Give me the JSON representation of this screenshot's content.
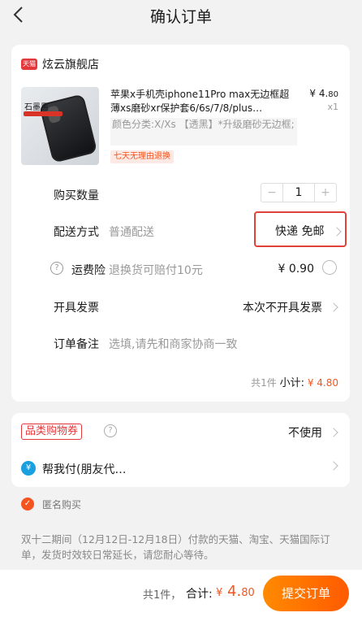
{
  "header": {
    "title": "确认订单"
  },
  "shop": {
    "logo_text": "天猫",
    "name": "炫云旗舰店"
  },
  "product": {
    "title": "苹果x手机壳iphone11Pro max无边框超薄xs磨砂xr保护套6/6s/7/8/plus…",
    "price_symbol": "¥",
    "price_int": "4.",
    "price_dec": "80",
    "quantity": "x1",
    "sku": "颜色分类:X/Xs 【透黑】*升级磨砂无边框;",
    "badge": "七天无理由退换",
    "thumb_text": "石墨黑"
  },
  "rows": {
    "qty": {
      "label": "购买数量",
      "minus": "−",
      "value": "1",
      "plus": "+"
    },
    "delivery": {
      "label": "配送方式",
      "sub": "普通配送",
      "value": "快递 免邮"
    },
    "insurance": {
      "label": "运费险",
      "sub": "退换货可赔付10元",
      "value": "¥ 0.90"
    },
    "invoice": {
      "label": "开具发票",
      "value": "本次不开具发票"
    },
    "remark": {
      "label": "订单备注",
      "placeholder": "选填,请先和商家协商一致"
    }
  },
  "subtotal": {
    "count": "共1件",
    "label": "小计:",
    "value": "¥ 4.80"
  },
  "coupon": {
    "label": "品类购物券",
    "value": "不使用"
  },
  "pay": {
    "icon_text": "¥",
    "label": "帮我付(朋友代…"
  },
  "anonymous": {
    "label": "匿名购买"
  },
  "notice": "双十二期间（12月12日-12月18日）付款的天猫、淘宝、天猫国际订单，发货时效较日常延长，请您耐心等待。",
  "footer": {
    "count": "共1件，",
    "total_label": "合计:",
    "total_symbol": "¥",
    "total_int": "4.",
    "total_dec": "80",
    "submit": "提交订单"
  },
  "colors": {
    "accent": "#f5541f",
    "highlight_border": "#e0423a",
    "tmall_red": "#e4393c"
  }
}
